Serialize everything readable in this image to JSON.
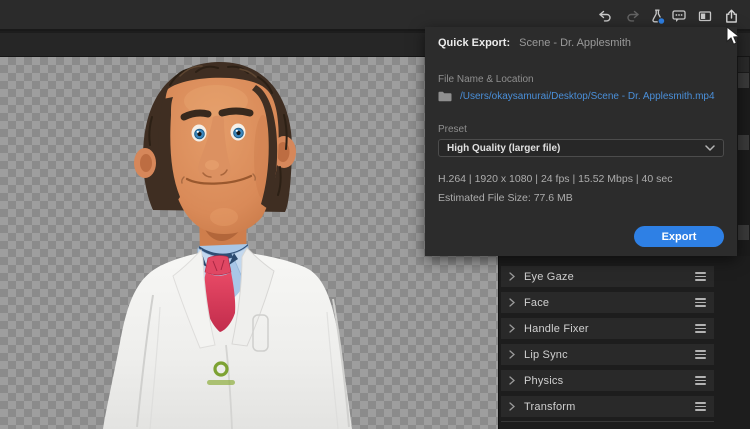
{
  "colors": {
    "accent_blue": "#2e80e5",
    "link_blue": "#4a8fd9",
    "panel_bg": "#2c2c2c",
    "tie_red": "#d93a58",
    "coat_white": "#f3f3f1",
    "skin": "#d98a58",
    "hair_brown": "#3f2e22",
    "logo_green": "#7da233"
  },
  "toolbar": {
    "icons": [
      {
        "name": "undo-icon",
        "enabled": true
      },
      {
        "name": "redo-icon",
        "enabled": false
      },
      {
        "name": "beaker-icon",
        "badge": true
      },
      {
        "name": "comments-icon"
      },
      {
        "name": "panel-view-icon"
      },
      {
        "name": "export-share-icon"
      }
    ]
  },
  "quick_export": {
    "title": "Quick Export:",
    "scene_name": "Scene - Dr. Applesmith",
    "file_label": "File Name & Location",
    "file_path": "/Users/okaysamurai/Desktop/Scene - Dr. Applesmith.mp4",
    "preset_label": "Preset",
    "preset_value": "High Quality (larger file)",
    "specs": "H.264 | 1920 x 1080 | 24 fps | 15.52 Mbps | 40 sec",
    "estimated_size": "Estimated File Size: 77.6 MB",
    "export_label": "Export"
  },
  "behaviors": {
    "items": [
      {
        "label": "Eye Gaze"
      },
      {
        "label": "Face"
      },
      {
        "label": "Handle Fixer"
      },
      {
        "label": "Lip Sync"
      },
      {
        "label": "Physics"
      },
      {
        "label": "Transform"
      }
    ]
  }
}
